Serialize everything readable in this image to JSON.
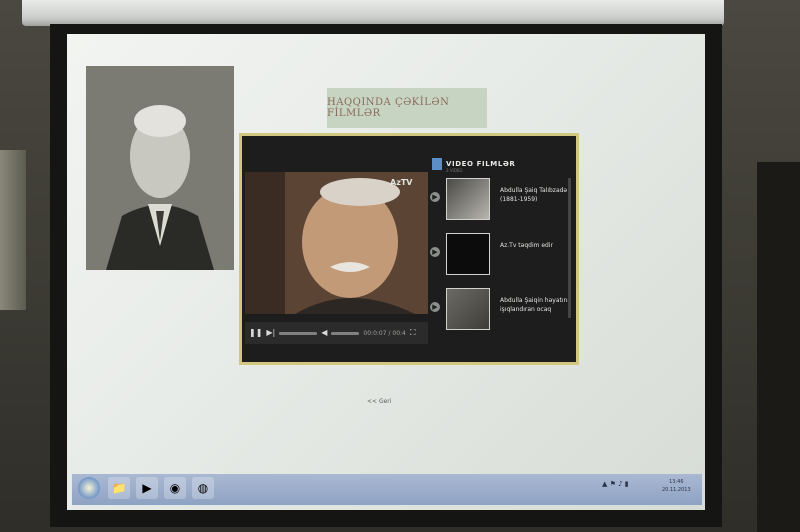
{
  "slide": {
    "title": "HAQQINDA ÇƏKİLƏN FİLMLƏR",
    "back_link": "<< Geri"
  },
  "player": {
    "channel_logo": "AzTV",
    "time": "00:0:07 / 00:4",
    "playlist_title": "VIDEO FILMLƏR",
    "playlist_subtitle": "3 VIDEO",
    "items": [
      {
        "text": "Abdulla Şaiq Talıbzadə (1881-1959)"
      },
      {
        "text": "Az.Tv təqdim edir"
      },
      {
        "text": "Abdulla Şaiqin həyatını işıqlandıran ocaq"
      }
    ]
  },
  "taskbar": {
    "clock_time": "13:46",
    "clock_date": "20.11.2013"
  },
  "colors": {
    "player_border": "#d2c77e",
    "title_box": "#c8d4c2",
    "taskbar": "#8ea2c3"
  }
}
